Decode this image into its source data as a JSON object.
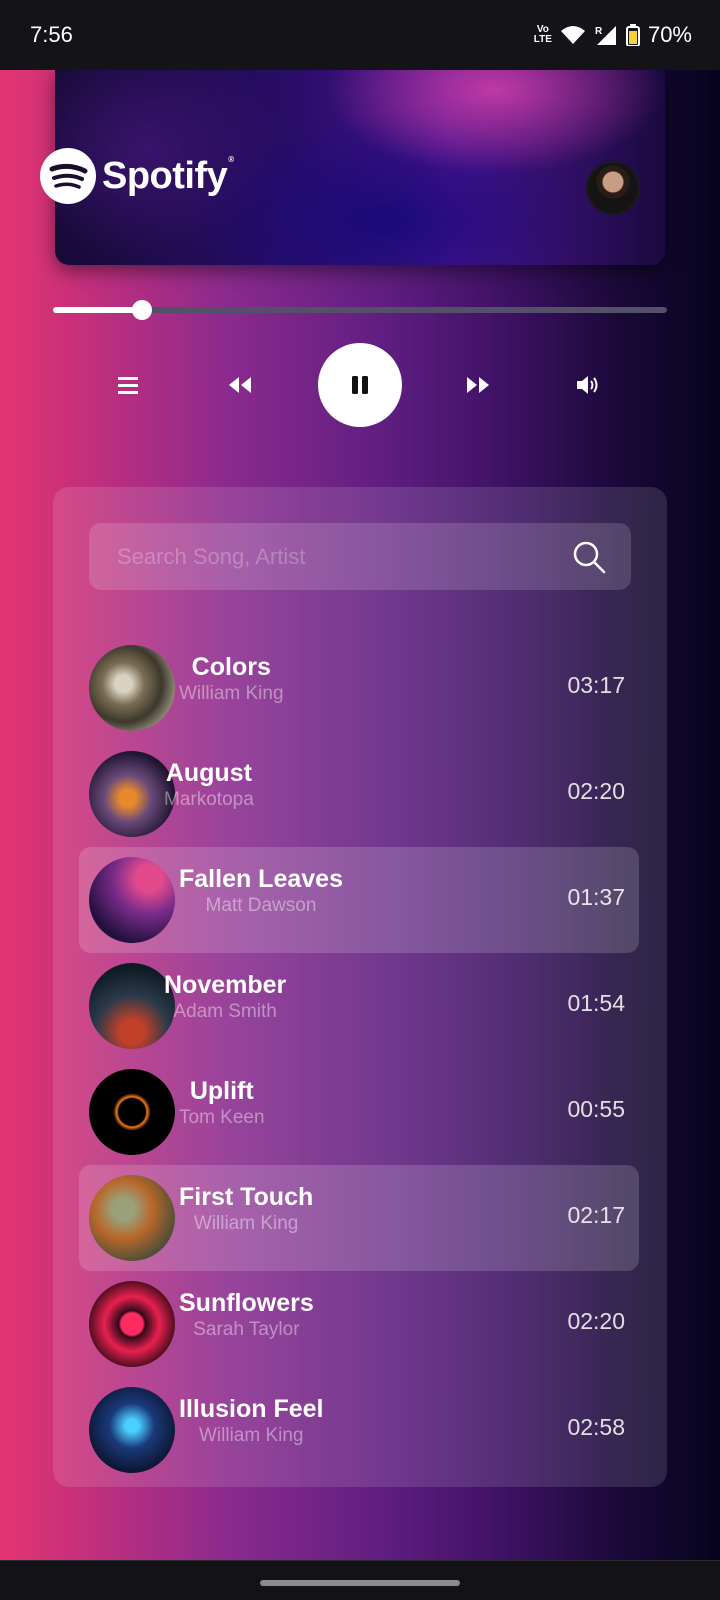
{
  "status_bar": {
    "time": "7:56",
    "battery": "70%",
    "network_label": "Vo LTE",
    "signal_label": "R",
    "icons": [
      "volte-icon",
      "wifi-icon",
      "signal-icon",
      "battery-icon"
    ]
  },
  "header": {
    "brand": "Spotify",
    "brand_mark": "®"
  },
  "player": {
    "progress_fraction": 0.145,
    "controls": [
      "menu-icon",
      "rewind-icon",
      "pause-icon",
      "fast-forward-icon",
      "volume-icon"
    ]
  },
  "search": {
    "placeholder": "Search Song, Artist",
    "value": ""
  },
  "songs": [
    {
      "title": "Colors",
      "artist": "William King",
      "duration": "03:17",
      "active": false
    },
    {
      "title": "August",
      "artist": "Markotopa",
      "duration": "02:20",
      "active": false
    },
    {
      "title": "Fallen Leaves",
      "artist": "Matt Dawson",
      "duration": "01:37",
      "active": true
    },
    {
      "title": "November",
      "artist": "Adam Smith",
      "duration": "01:54",
      "active": false
    },
    {
      "title": "Uplift",
      "artist": "Tom Keen",
      "duration": "00:55",
      "active": false
    },
    {
      "title": "First Touch",
      "artist": "William King",
      "duration": "02:17",
      "active": true
    },
    {
      "title": "Sunflowers",
      "artist": "Sarah Taylor",
      "duration": "02:20",
      "active": false
    },
    {
      "title": "Illusion Feel",
      "artist": "William King",
      "duration": "02:58",
      "active": false
    }
  ],
  "colors": {
    "accent_white": "#ffffff",
    "gradient_left": "#e3356f",
    "gradient_mid": "#5c1d7e",
    "gradient_right": "#06041e"
  }
}
